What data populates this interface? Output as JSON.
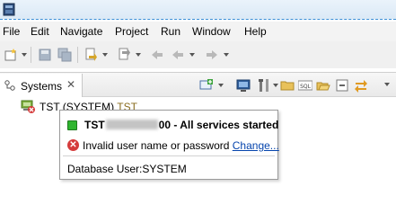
{
  "menu": [
    "File",
    "Edit",
    "Navigate",
    "Project",
    "Run",
    "Window",
    "Help"
  ],
  "view": {
    "tab_label": "Systems",
    "close_glyph": "✕"
  },
  "tree": {
    "item_label": "TST (SYSTEM)",
    "item_suffix": "TST"
  },
  "tooltip": {
    "title_prefix": "TST",
    "title_suffix": "00 - All services started",
    "error_text": "Invalid user name or password",
    "error_link": "Change...",
    "db_user": "Database User:SYSTEM",
    "status_color": "#2fb52f",
    "error_color": "#d53c3c"
  },
  "icons": {
    "toolbar": [
      "new-icon",
      "save-icon",
      "save-all-icon",
      "print-icon",
      "next-annotation-icon",
      "prev-annotation-icon",
      "back-icon",
      "forward-icon"
    ],
    "view": [
      "add-system-icon",
      "monitor-icon",
      "tools-icon",
      "folder-icon",
      "sql-console-icon",
      "open-icon",
      "collapse-icon",
      "link-editor-icon",
      "view-menu-icon"
    ]
  }
}
